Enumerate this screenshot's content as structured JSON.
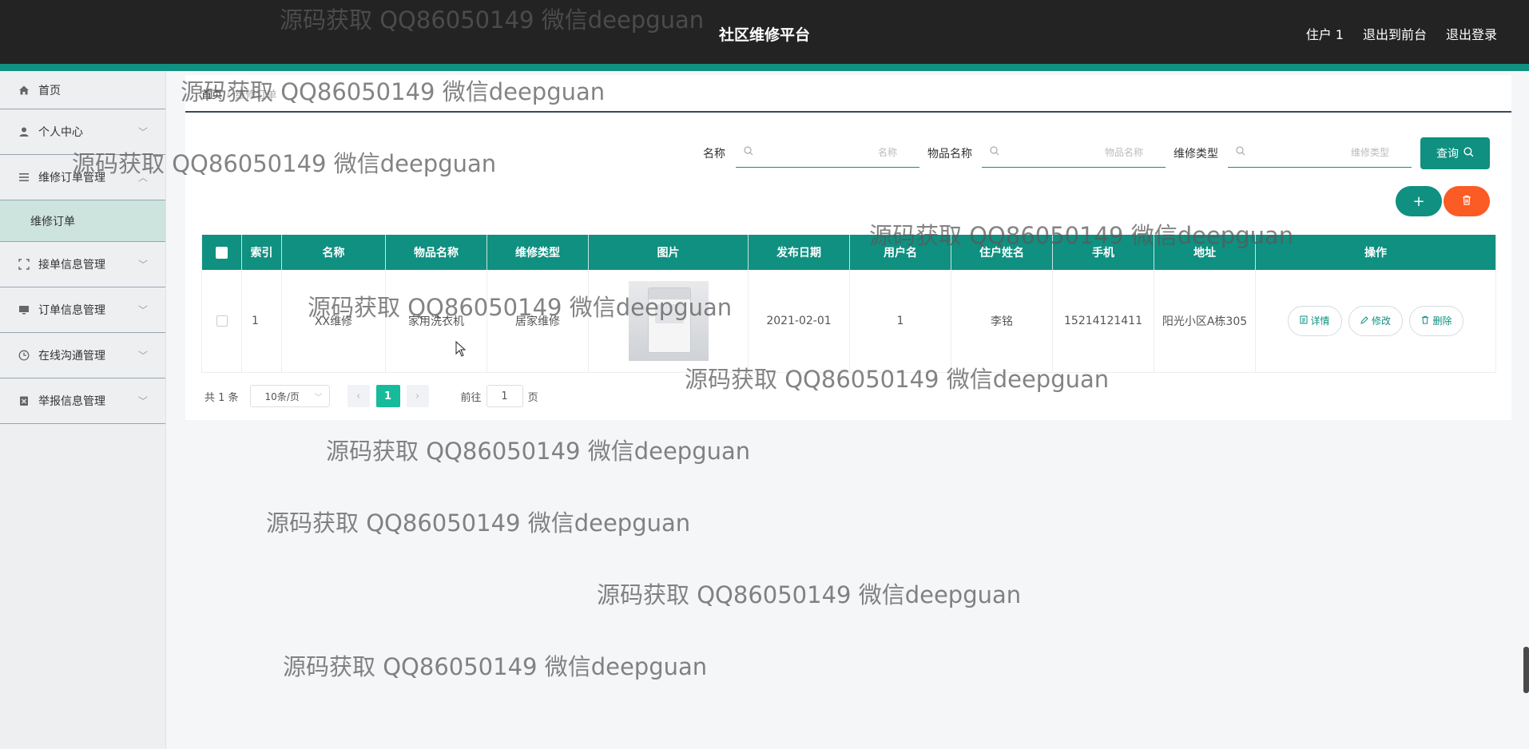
{
  "header": {
    "title": "社区维修平台",
    "user": "住户 1",
    "front_link": "退出到前台",
    "logout": "退出登录"
  },
  "sidebar": {
    "items": [
      {
        "label": "首页",
        "icon": "home-icon"
      },
      {
        "label": "个人中心",
        "icon": "user-icon"
      },
      {
        "label": "维修订单管理",
        "icon": "list-icon",
        "expanded": true,
        "children": [
          {
            "label": "维修订单"
          }
        ]
      },
      {
        "label": "接单信息管理",
        "icon": "scan-icon"
      },
      {
        "label": "订单信息管理",
        "icon": "monitor-icon"
      },
      {
        "label": "在线沟通管理",
        "icon": "clock-icon"
      },
      {
        "label": "举报信息管理",
        "icon": "report-icon"
      }
    ]
  },
  "breadcrumb": {
    "home": "首页",
    "current": "维修订单"
  },
  "search": {
    "name_label": "名称",
    "name_placeholder": "名称",
    "item_label": "物品名称",
    "item_placeholder": "物品名称",
    "type_label": "维修类型",
    "type_placeholder": "维修类型",
    "query_label": "查询"
  },
  "actions": {
    "add": "+",
    "delete": "🗑"
  },
  "table": {
    "columns": [
      "",
      "索引",
      "名称",
      "物品名称",
      "维修类型",
      "图片",
      "发布日期",
      "用户名",
      "住户姓名",
      "手机",
      "地址",
      "操作"
    ],
    "rows": [
      {
        "index": "1",
        "name": "XX维修",
        "item": "家用洗衣机",
        "type": "居家维修",
        "date": "2021-02-01",
        "username": "1",
        "resident": "李铭",
        "phone": "15214121411",
        "address": "阳光小区A栋305",
        "ops": {
          "detail": "详情",
          "edit": "修改",
          "delete": "删除"
        }
      }
    ]
  },
  "pagination": {
    "total": "共 1 条",
    "page_size": "10条/页",
    "current_page": "1",
    "goto_prefix": "前往",
    "goto_value": "1",
    "goto_suffix": "页"
  },
  "watermark": "源码获取 QQ86050149 微信deepguan",
  "colors": {
    "header_bg": "#232323",
    "accent": "#0f9080",
    "danger": "#fb5b24",
    "active_sub": "#cde3dd"
  }
}
